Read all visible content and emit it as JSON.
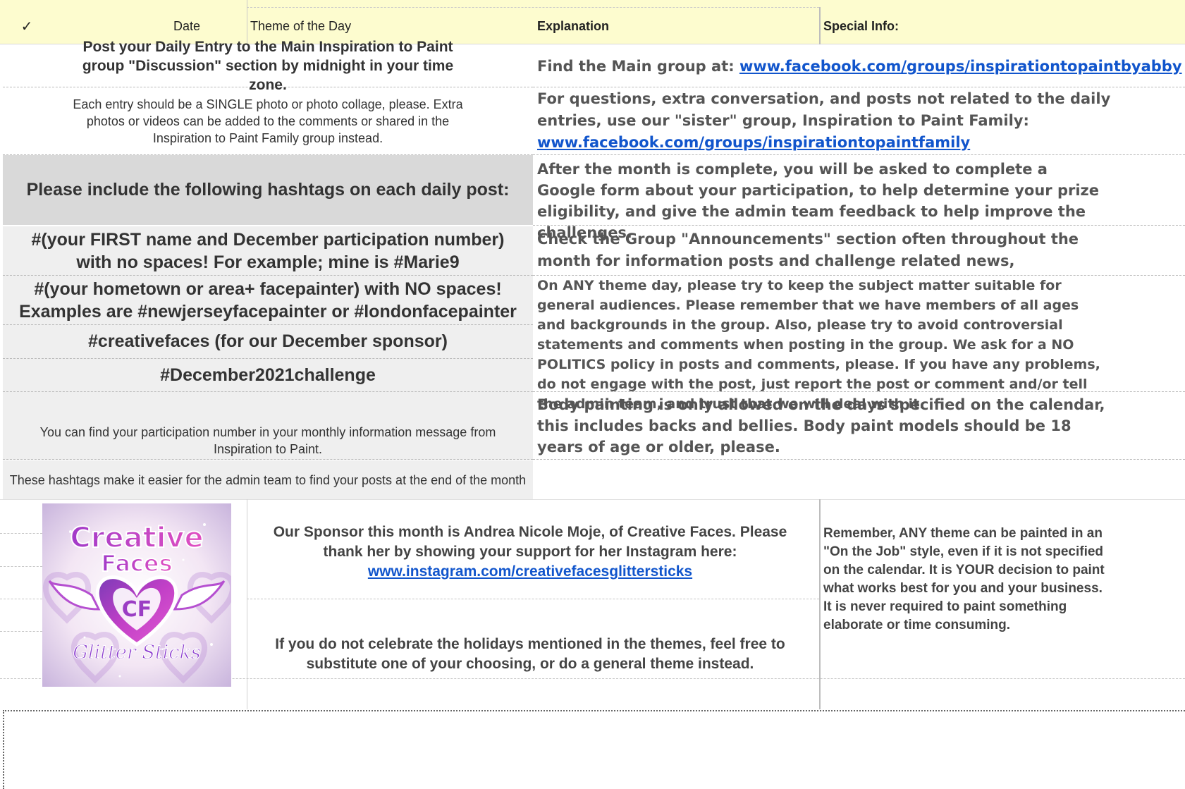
{
  "header": {
    "check_label": "✓",
    "date_label": "Date",
    "theme_label": "Theme of the Day",
    "explanation_label": "Explanation",
    "special_label": "Special Info:",
    "bg_color": "#fdfccf"
  },
  "left": {
    "post_entry": "Post your Daily Entry to the Main Inspiration to Paint group \"Discussion\" section by midnight in your time zone.",
    "single_photo": "Each entry should be a SINGLE photo or photo collage, please. Extra photos or videos can be added to the comments or shared in the Inspiration to Paint Family group instead.",
    "hashtags_heading": "Please include the following hashtags on each daily post:",
    "tag_first_name": "#(your FIRST name and December participation number) with no spaces! For example; mine is #Marie9",
    "tag_hometown": "#(your hometown or area+ facepainter) with NO spaces! Examples are #newjerseyfacepainter or #londonfacepainter",
    "tag_sponsor": "#creativefaces (for our December sponsor)",
    "tag_challenge": "#December2021challenge",
    "participation_number": "You can find your participation number in your monthly information message from Inspiration to Paint.",
    "admin_note": "These hashtags make it easier for the admin team to find your posts at the end of the month"
  },
  "right": {
    "main_group_prefix": "Find the Main group at: ",
    "main_group_link": "www.facebook.com/groups/inspirationtopaintbyabby",
    "questions_prefix": "For questions, extra conversation, and posts not related to the daily entries, use our \"sister\" group, Inspiration to Paint Family: ",
    "family_link": "www.facebook.com/groups/inspirationtopaintfamily",
    "google_form": "After the month is complete, you will be asked to complete a Google form about your participation, to help determine your prize eligibility, and give the admin team feedback to help improve the challenges.",
    "announcements": "Check the Group \"Announcements\" section often throughout the month for information posts and challenge related news,",
    "any_theme_day": "On ANY theme day, please try to keep the subject matter suitable for general audiences. Please remember that we have members of all ages and backgrounds in the group. Also, please try to avoid controversial statements and comments when posting in the group. We ask for a NO POLITICS policy in posts and comments, please. If you have any problems, do not engage with the post, just report the post or comment and/or tell the admin team, and trust that we will deal with it.",
    "body_painting": "Body painting is only allowed on the days specified on the calendar, this includes backs and bellies. Body paint models should be 18 years of age or older, please."
  },
  "sponsor": {
    "text_prefix": "Our Sponsor this month is Andrea Nicole Moje, of Creative Faces. Please thank her by showing your support for her Instagram here: ",
    "link": "www.instagram.com/creativefacesglittersticks",
    "holidays": "If you do not celebrate the holidays mentioned in the themes, feel free to substitute one of your choosing, or do a general theme instead.",
    "remember": "Remember, ANY theme can be painted in an \"On the Job\" style, even if it is not specified on the calendar. It is YOUR decision to paint what works best for you and your business. It is never required to paint something elaborate or time consuming."
  },
  "logo": {
    "line1": "Creative",
    "line2": "Faces",
    "monogram": "CF",
    "line3": "Glitter Sticks"
  }
}
